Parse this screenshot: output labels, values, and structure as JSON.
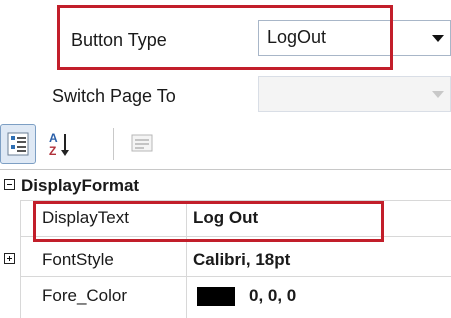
{
  "properties_top": [
    {
      "label": "Button Type",
      "value": "LogOut",
      "enabled": true
    },
    {
      "label": "Switch Page To",
      "value": "",
      "enabled": false
    }
  ],
  "toolbar": {
    "categorized_icon": "categorized-icon",
    "alphabetical_icon": "sort-az-icon",
    "property_pages_icon": "property-pages-icon",
    "alphabetical_glyph": "A​Z"
  },
  "grid": {
    "category": {
      "label": "DisplayFormat",
      "expanded": true
    },
    "rows": [
      {
        "name": "DisplayText",
        "value": "Log Out",
        "expandable": false
      },
      {
        "name": "FontStyle",
        "value": "Calibri, 18pt",
        "expandable": true
      },
      {
        "name": "Fore_Color",
        "value": "0, 0, 0",
        "expandable": false,
        "swatch_color": "#000000"
      }
    ]
  },
  "highlight_color": "#c21e2a"
}
